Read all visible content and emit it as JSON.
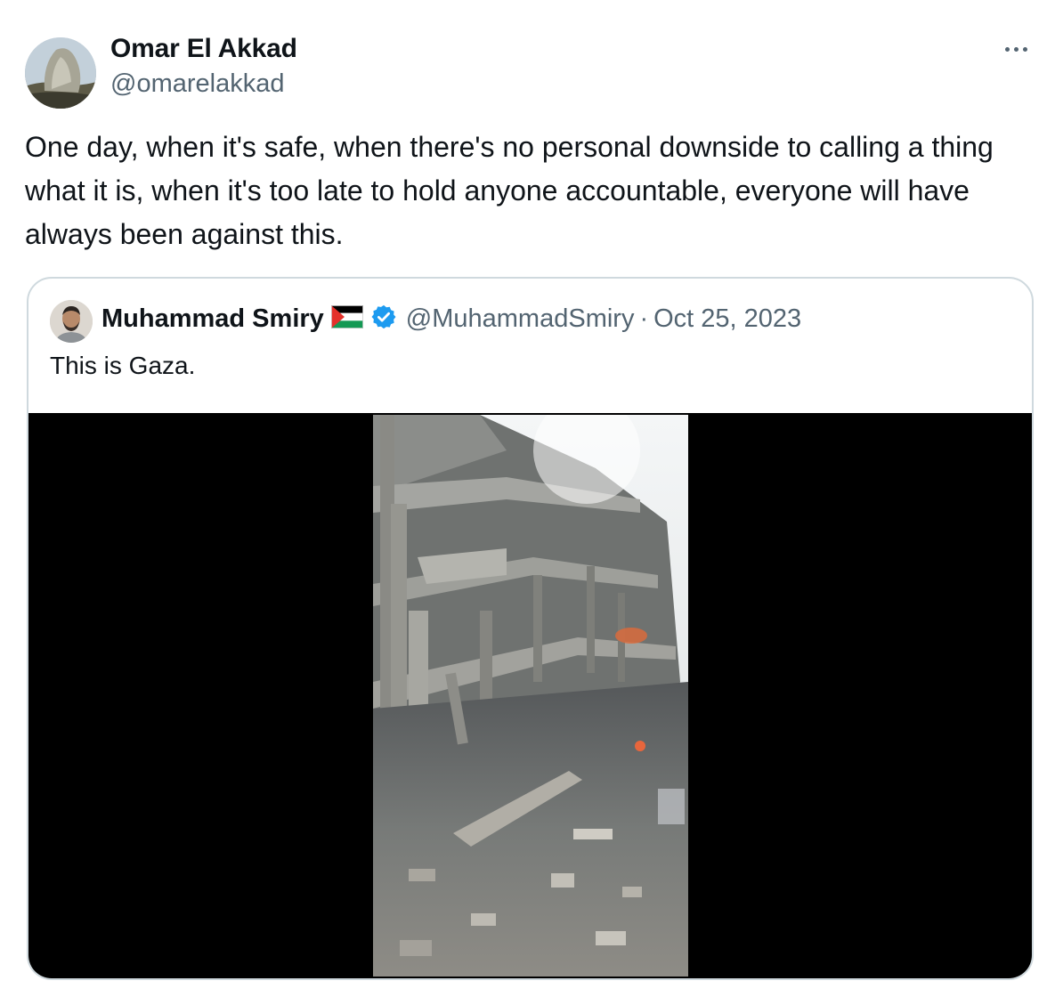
{
  "author": {
    "name": "Omar El Akkad",
    "handle": "@omarelakkad"
  },
  "tweet": {
    "text": "One day, when it's safe, when there's no personal downside to calling a thing what it is, when it's too late to hold anyone accountable, everyone will have always been against this."
  },
  "quote": {
    "name": "Muhammad Smiry",
    "handle": "@MuhammadSmiry",
    "separator": "·",
    "date": "Oct 25, 2023",
    "text": "This is Gaza."
  },
  "icons": {
    "more": "more-horizontal-icon",
    "flag": "palestine-flag-icon",
    "verified": "verified-badge-icon"
  },
  "colors": {
    "secondary_text": "#536471",
    "verified_blue": "#1d9bf0",
    "border": "#cfd9de"
  }
}
